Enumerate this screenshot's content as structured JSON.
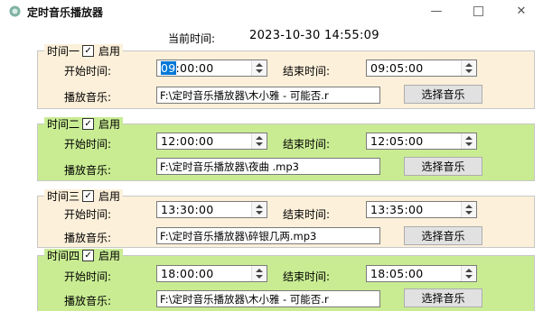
{
  "window": {
    "title": "定时音乐播放器",
    "minimize_glyph": "—",
    "close_glyph": "✕"
  },
  "header": {
    "current_time_label": "当前时间:",
    "current_time": "2023-10-30 14:55:09"
  },
  "labels": {
    "start": "开始时间:",
    "end": "结束时间:",
    "music": "播放音乐:",
    "enable": "启用",
    "select_music": "选择音乐",
    "check_glyph": "✓"
  },
  "groups": [
    {
      "name": "时间一",
      "enabled": true,
      "start_selected": "09",
      "start_rest": ":00:00",
      "end": "09:05:00",
      "music": "F:\\定时音乐播放器\\木小雅 - 可能否.r"
    },
    {
      "name": "时间二",
      "enabled": true,
      "start_selected": "",
      "start_rest": "12:00:00",
      "end": "12:05:00",
      "music": "F:\\定时音乐播放器\\夜曲 .mp3"
    },
    {
      "name": "时间三",
      "enabled": true,
      "start_selected": "",
      "start_rest": "13:30:00",
      "end": "13:35:00",
      "music": "F:\\定时音乐播放器\\碎银几两.mp3"
    },
    {
      "name": "时间四",
      "enabled": true,
      "start_selected": "",
      "start_rest": "18:00:00",
      "end": "18:05:00",
      "music": "F:\\定时音乐播放器\\木小雅 - 可能否.r"
    }
  ],
  "colors": {
    "orange_panel": "#fdf0da",
    "green_panel": "#c9ec93",
    "selection": "#0078d7"
  }
}
